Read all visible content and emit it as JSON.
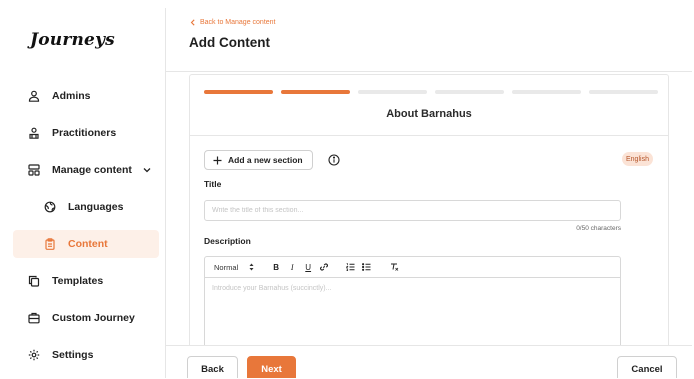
{
  "app": {
    "logo_text": "Journeys"
  },
  "sidebar": {
    "items": [
      {
        "label": "Admins",
        "icon": "user-icon"
      },
      {
        "label": "Practitioners",
        "icon": "users-icon"
      },
      {
        "label": "Manage content",
        "icon": "layout-icon",
        "expanded": true
      },
      {
        "label": "Languages",
        "icon": "globe-icon"
      },
      {
        "label": "Content",
        "icon": "clipboard-icon",
        "active": true
      },
      {
        "label": "Templates",
        "icon": "copy-icon"
      },
      {
        "label": "Custom Journey",
        "icon": "briefcase-icon"
      },
      {
        "label": "Settings",
        "icon": "gear-icon"
      }
    ]
  },
  "header": {
    "back_link": "Back to Manage content",
    "title": "Add Content"
  },
  "form": {
    "steps_total": 6,
    "steps_completed": 2,
    "section_title": "About Barnahus",
    "add_section_label": "Add a new section",
    "language_badge": "English",
    "title_label": "Title",
    "title_placeholder": "Write the title of this section...",
    "title_value": "",
    "char_count": "0/50 characters",
    "description_label": "Description",
    "toolbar": {
      "format_select": "Normal",
      "buttons": [
        "B",
        "I",
        "U"
      ]
    },
    "description_placeholder": "Introduce your Barnahus (succinctly)..."
  },
  "footer": {
    "back_label": "Back",
    "next_label": "Next",
    "cancel_label": "Cancel"
  },
  "colors": {
    "accent": "#e8773a",
    "active_bg": "#fdf0e8",
    "badge_bg": "#fbe3d6",
    "step_inactive": "#e9e9e9"
  }
}
